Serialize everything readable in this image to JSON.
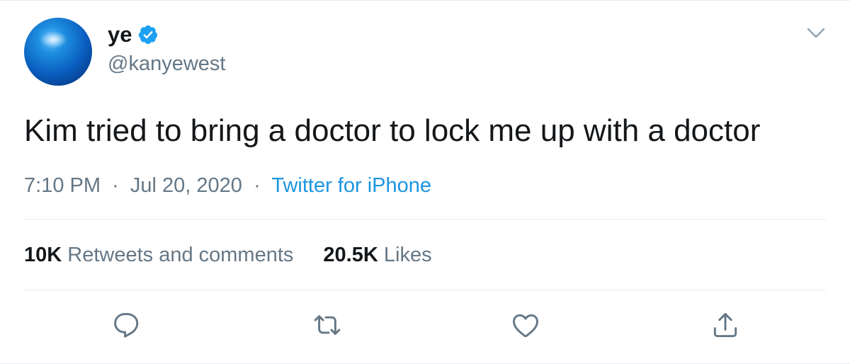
{
  "header": {
    "display_name": "ye",
    "handle": "@kanyewest",
    "verified_icon": "verified-badge-icon",
    "menu_icon": "chevron-down-icon"
  },
  "tweet": {
    "text": "Kim tried to bring a doctor to lock me up with a doctor",
    "time": "7:10 PM",
    "date": "Jul 20, 2020",
    "dot": "·",
    "source": "Twitter for iPhone"
  },
  "stats": {
    "retweets_count": "10K",
    "retweets_label": "Retweets and comments",
    "likes_count": "20.5K",
    "likes_label": "Likes"
  },
  "actions": [
    "reply-icon",
    "retweet-icon",
    "like-icon",
    "share-icon"
  ],
  "colors": {
    "text": "#14171a",
    "secondary": "#657786",
    "accent": "#1b95e0",
    "divider": "#e6ecf0"
  }
}
